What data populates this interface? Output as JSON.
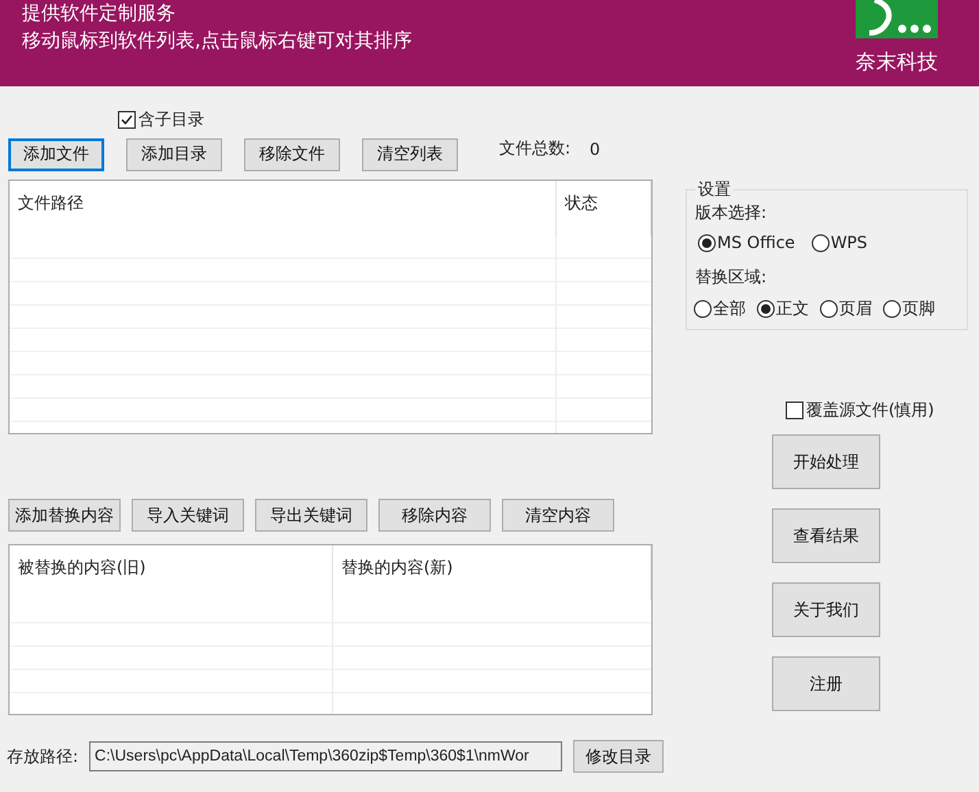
{
  "header": {
    "lines": [
      "提供软件定制服务",
      "移动鼠标到软件列表,点击鼠标右键可对其排序"
    ],
    "brand": "奈末科技"
  },
  "include_subdirs": {
    "label": "含子目录",
    "checked": true
  },
  "file_buttons": [
    {
      "label": "添加文件",
      "focused": true
    },
    {
      "label": "添加目录",
      "focused": false
    },
    {
      "label": "移除文件",
      "focused": false
    },
    {
      "label": "清空列表",
      "focused": false
    }
  ],
  "file_count": {
    "label": "文件总数:",
    "value": "0"
  },
  "file_table": {
    "columns": [
      "文件路径",
      "状态"
    ]
  },
  "replace_buttons": [
    "添加替换内容",
    "导入关键词",
    "导出关键词",
    "移除内容",
    "清空内容"
  ],
  "replace_table": {
    "columns": [
      "被替换的内容(旧)",
      "替换的内容(新)"
    ]
  },
  "save_path": {
    "label": "存放路径:",
    "value": "C:\\Users\\pc\\AppData\\Local\\Temp\\360zip$Temp\\360$1\\nmWor",
    "button": "修改目录"
  },
  "settings": {
    "title": "设置",
    "version_label": "版本选择:",
    "versions": [
      {
        "label": "MS Office",
        "selected": true
      },
      {
        "label": "WPS",
        "selected": false
      }
    ],
    "area_label": "替换区域:",
    "areas": [
      {
        "label": "全部",
        "selected": false
      },
      {
        "label": "正文",
        "selected": true
      },
      {
        "label": "页眉",
        "selected": false
      },
      {
        "label": "页脚",
        "selected": false
      }
    ]
  },
  "overwrite": {
    "label": "覆盖源文件(慎用)",
    "checked": false
  },
  "action_buttons": [
    "开始处理",
    "查看结果",
    "关于我们",
    "注册"
  ]
}
